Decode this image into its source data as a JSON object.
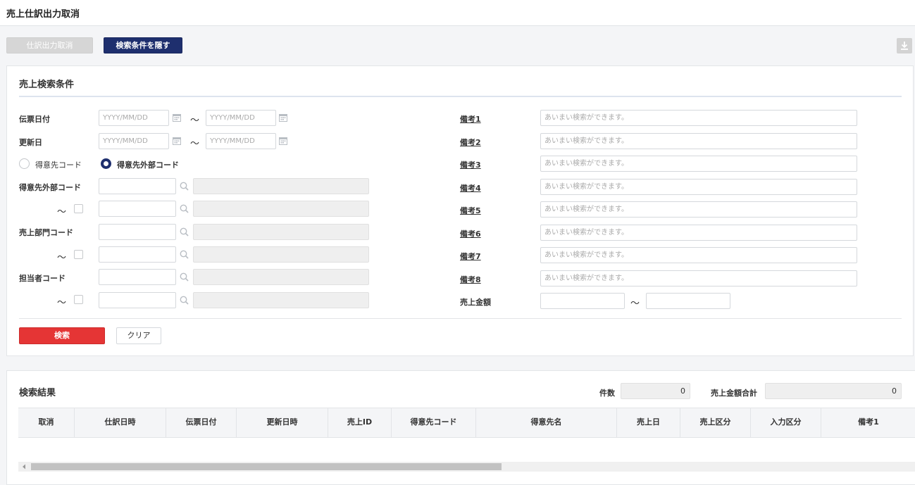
{
  "page": {
    "title": "売上仕訳出力取消"
  },
  "toolbar": {
    "cancel_export_label": "仕訳出力取消",
    "toggle_label": "検索条件を隠す"
  },
  "search": {
    "title": "売上検索条件",
    "date_placeholder": "YYYY/MM/DD",
    "tilde": "～",
    "slip_date_label": "伝票日付",
    "update_date_label": "更新日",
    "radio_customer_code": "得意先コード",
    "radio_customer_ext_code": "得意先外部コード",
    "radio_selected": "得意先外部コード",
    "customer_ext_code_label": "得意先外部コード",
    "sales_dept_code_label": "売上部門コード",
    "staff_code_label": "担当者コード",
    "remarks_placeholder": "あいまい検索ができます。",
    "remarks": [
      "備考1",
      "備考2",
      "備考3",
      "備考4",
      "備考5",
      "備考6",
      "備考7",
      "備考8"
    ],
    "amount_label": "売上金額",
    "search_button": "検索",
    "clear_button": "クリア"
  },
  "results": {
    "title": "検索結果",
    "count_label": "件数",
    "count_value": "0",
    "total_label": "売上金額合計",
    "total_value": "0",
    "columns": [
      "取消",
      "仕訳日時",
      "伝票日付",
      "更新日時",
      "売上ID",
      "得意先コード",
      "得意先名",
      "売上日",
      "売上区分",
      "入力区分",
      "備考1"
    ],
    "scroll_position": 0.0
  },
  "colors": {
    "navy": "#1e2f6e",
    "red": "#e53535"
  },
  "icons": [
    "calendar-icon",
    "search-icon",
    "download-icon",
    "chevron-left-icon"
  ]
}
